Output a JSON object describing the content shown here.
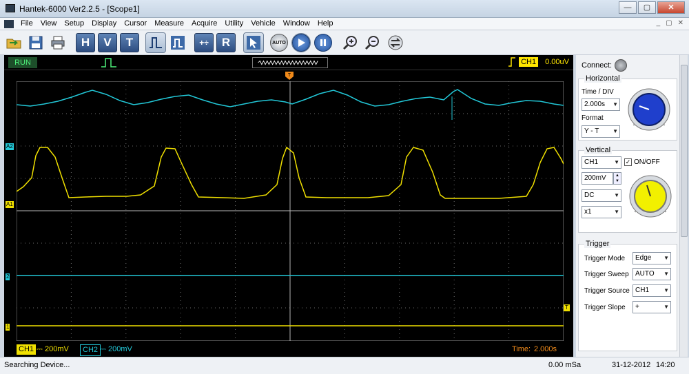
{
  "window": {
    "title": "Hantek-6000 Ver2.2.5 - [Scope1]",
    "minimize": "—",
    "maximize": "▢",
    "close": "✕"
  },
  "menu": [
    "File",
    "View",
    "Setup",
    "Display",
    "Cursor",
    "Measure",
    "Acquire",
    "Utility",
    "Vehicle",
    "Window",
    "Help"
  ],
  "mdi_buttons": [
    "_",
    "▢",
    "✕"
  ],
  "toolbar": {
    "letters": [
      "H",
      "V",
      "T",
      "R"
    ],
    "auto_label": "AUTO"
  },
  "scope": {
    "run_state": "RUN",
    "trigger_channel": "CH1",
    "trigger_level": "0.00uV",
    "trigger_marker": "T",
    "ch1_scale": "200mV",
    "ch2_scale": "200mV",
    "ch1_label": "CH1",
    "ch2_label": "CH2",
    "coupling_symbol": "⎓",
    "time_label": "Time:",
    "time_value": "2.000s",
    "markers": {
      "a2": "A2",
      "a1": "A1",
      "ch2": "2",
      "ch1": "1",
      "trig": "T"
    },
    "colors": {
      "ch1": "#f0e000",
      "ch2": "#22c8d8",
      "grid": "#9a9a9a",
      "run": "#4ef07a"
    }
  },
  "panel": {
    "connect_label": "Connect:",
    "horizontal": {
      "title": "Horizontal",
      "time_div_label": "Time / DIV",
      "time_div_value": "2.000s",
      "format_label": "Format",
      "format_value": "Y - T"
    },
    "vertical": {
      "title": "Vertical",
      "channel": "CH1",
      "onoff_label": "ON/OFF",
      "onoff_checked": true,
      "volts": "200mV",
      "coupling": "DC",
      "probe": "x1"
    },
    "trigger": {
      "title": "Trigger",
      "mode_label": "Trigger Mode",
      "mode_value": "Edge",
      "sweep_label": "Trigger Sweep",
      "sweep_value": "AUTO",
      "source_label": "Trigger Source",
      "source_value": "CH1",
      "slope_label": "Trigger Slope",
      "slope_value": "+"
    }
  },
  "status": {
    "message": "Searching Device...",
    "sample_rate": "0.00 mSa",
    "date": "31-12-2012",
    "time": "14:20"
  }
}
